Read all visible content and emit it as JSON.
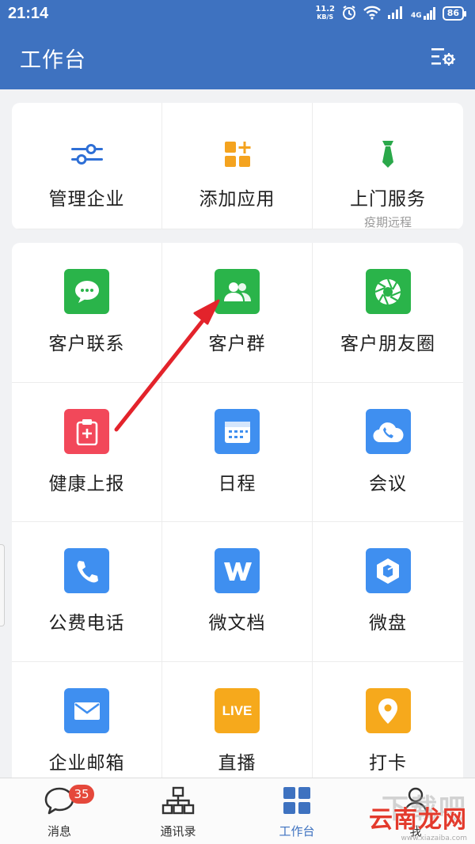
{
  "status_bar": {
    "time": "21:14",
    "net_speed_value": "11.2",
    "net_speed_unit": "KB/S",
    "signal_label": "4G",
    "battery": "86"
  },
  "header": {
    "title": "工作台",
    "settings_icon": "settings-list-icon"
  },
  "top_actions": [
    {
      "label": "管理企业",
      "sub": "",
      "icon": "sliders-icon",
      "color": "#2e6fd6"
    },
    {
      "label": "添加应用",
      "sub": "",
      "icon": "add-app-icon",
      "color": "#f4a31f"
    },
    {
      "label": "上门服务",
      "sub": "疫期远程",
      "icon": "tie-icon",
      "color": "#2aa84a"
    }
  ],
  "apps": [
    {
      "label": "客户联系",
      "icon": "chat-bubble-icon",
      "color": "#2ab44a"
    },
    {
      "label": "客户群",
      "icon": "people-group-icon",
      "color": "#2ab44a"
    },
    {
      "label": "客户朋友圈",
      "icon": "aperture-icon",
      "color": "#2ab44a"
    },
    {
      "label": "健康上报",
      "icon": "clipboard-plus-icon",
      "color": "#f2485a"
    },
    {
      "label": "日程",
      "icon": "calendar-icon",
      "color": "#3f8ff0"
    },
    {
      "label": "会议",
      "icon": "cloud-phone-icon",
      "color": "#3f8ff0"
    },
    {
      "label": "公费电话",
      "icon": "phone-icon",
      "color": "#3f8ff0"
    },
    {
      "label": "微文档",
      "icon": "w-doc-icon",
      "color": "#3f8ff0"
    },
    {
      "label": "微盘",
      "icon": "cube-drive-icon",
      "color": "#3f8ff0"
    },
    {
      "label": "企业邮箱",
      "icon": "mail-icon",
      "color": "#3f8ff0"
    },
    {
      "label": "直播",
      "icon": "live-icon",
      "color": "#f6a91c"
    },
    {
      "label": "打卡",
      "icon": "location-pin-icon",
      "color": "#f6a91c"
    }
  ],
  "live_badge_text": "LIVE",
  "bottom_nav": [
    {
      "label": "消息",
      "icon": "message-bubble-icon",
      "badge": "35",
      "active": false
    },
    {
      "label": "通讯录",
      "icon": "org-chart-icon",
      "badge": "",
      "active": false
    },
    {
      "label": "工作台",
      "icon": "grid-icon",
      "badge": "",
      "active": true
    },
    {
      "label": "我",
      "icon": "person-icon",
      "badge": "",
      "active": false
    }
  ],
  "watermark": {
    "text": "云南龙网",
    "bg_text": "下载吧",
    "url": "www.xiazaiba.com"
  },
  "colors": {
    "header_bg": "#3e72c0",
    "arrow": "#e3232b"
  }
}
